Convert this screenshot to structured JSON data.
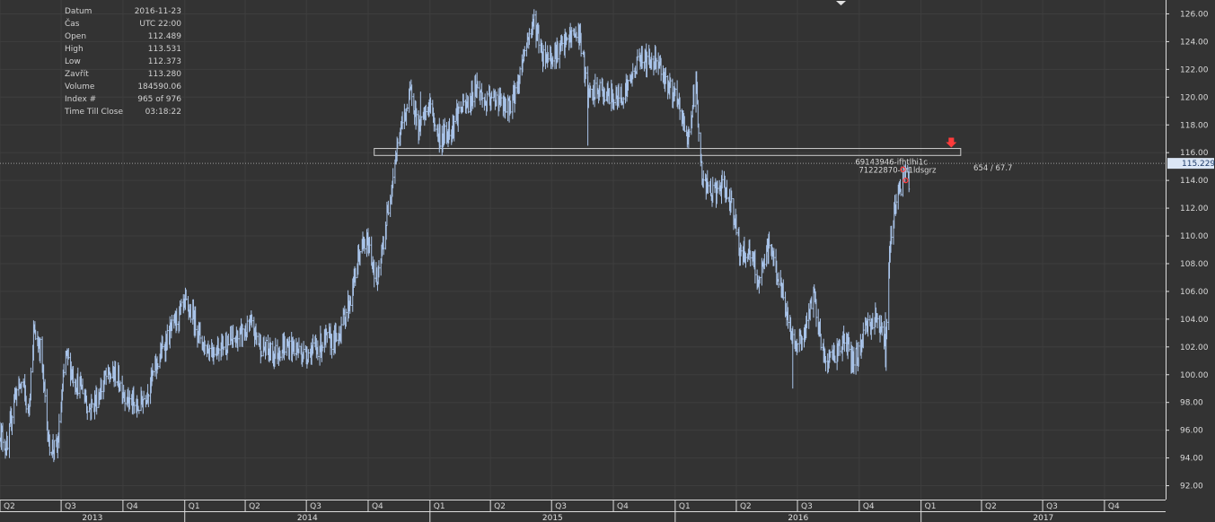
{
  "info": [
    {
      "key": "Datum",
      "value": "2016-11-23"
    },
    {
      "key": "Čas",
      "value": "UTC 22:00"
    },
    {
      "key": "Open",
      "value": "112.489"
    },
    {
      "key": "High",
      "value": "113.531"
    },
    {
      "key": "Low",
      "value": "112.373"
    },
    {
      "key": "Zavřít",
      "value": "113.280"
    },
    {
      "key": "Volume",
      "value": "184590.06"
    },
    {
      "key": "Index #",
      "value": "965 of 976"
    },
    {
      "key": "Time Till Close",
      "value": "03:18:22"
    }
  ],
  "current_price": {
    "label": "115.229",
    "value": 115.229
  },
  "annotations": {
    "rect_label_1": "69143946-ifhtlhi1c",
    "rect_label_2": "71222870-ifr1ldsgrz",
    "ratio_label": "654 / 67.7",
    "zone": {
      "from_date": "2014-10-10",
      "to_date": "2017-03-01",
      "low": 115.8,
      "high": 116.3
    }
  },
  "colors": {
    "background": "#333333",
    "grid": "#3e3e3e",
    "axis_panel": "#ffffff",
    "bars": "#a9c4ea",
    "marker": "#ff3b3b",
    "price_tag": "#dbe6f5",
    "zone": "#cfcfcf"
  },
  "chart_data": {
    "type": "ohlc",
    "title": "",
    "xlabel": "",
    "ylabel": "",
    "ylim": [
      91,
      127
    ],
    "xlim": [
      "2013-04-01",
      "2017-12-31"
    ],
    "y_ticks": [
      "92.00",
      "94.00",
      "96.00",
      "98.00",
      "100.00",
      "102.00",
      "104.00",
      "106.00",
      "108.00",
      "110.00",
      "112.00",
      "114.00",
      "116.00",
      "118.00",
      "120.00",
      "122.00",
      "124.00",
      "126.00"
    ],
    "quarters": [
      {
        "label": "Q2",
        "date": "2013-04-01"
      },
      {
        "label": "Q3",
        "date": "2013-07-01"
      },
      {
        "label": "Q4",
        "date": "2013-10-01"
      },
      {
        "label": "Q1",
        "date": "2014-01-01"
      },
      {
        "label": "Q2",
        "date": "2014-04-01"
      },
      {
        "label": "Q3",
        "date": "2014-07-01"
      },
      {
        "label": "Q4",
        "date": "2014-10-01"
      },
      {
        "label": "Q1",
        "date": "2015-01-01"
      },
      {
        "label": "Q2",
        "date": "2015-04-01"
      },
      {
        "label": "Q3",
        "date": "2015-07-01"
      },
      {
        "label": "Q4",
        "date": "2015-10-01"
      },
      {
        "label": "Q1",
        "date": "2016-01-01"
      },
      {
        "label": "Q2",
        "date": "2016-04-01"
      },
      {
        "label": "Q3",
        "date": "2016-07-01"
      },
      {
        "label": "Q4",
        "date": "2016-10-01"
      },
      {
        "label": "Q1",
        "date": "2017-01-01"
      },
      {
        "label": "Q2",
        "date": "2017-04-01"
      },
      {
        "label": "Q3",
        "date": "2017-07-01"
      },
      {
        "label": "Q4",
        "date": "2017-10-01"
      }
    ],
    "years": [
      {
        "label": "2013",
        "date": "2013-04-01"
      },
      {
        "label": "2014",
        "date": "2014-01-01"
      },
      {
        "label": "2015",
        "date": "2015-01-01"
      },
      {
        "label": "2016",
        "date": "2016-01-01"
      },
      {
        "label": "2017",
        "date": "2017-01-01"
      }
    ],
    "series_path": [
      [
        "2013-04-01",
        96.0
      ],
      [
        "2013-04-12",
        94.5
      ],
      [
        "2013-04-22",
        98.5
      ],
      [
        "2013-05-05",
        99.5
      ],
      [
        "2013-05-13",
        97.0
      ],
      [
        "2013-05-21",
        103.0
      ],
      [
        "2013-05-31",
        102.0
      ],
      [
        "2013-06-13",
        95.0
      ],
      [
        "2013-06-25",
        94.5
      ],
      [
        "2013-07-08",
        101.5
      ],
      [
        "2013-07-22",
        99.5
      ],
      [
        "2013-08-02",
        99.0
      ],
      [
        "2013-08-12",
        97.5
      ],
      [
        "2013-08-26",
        98.5
      ],
      [
        "2013-09-05",
        99.8
      ],
      [
        "2013-09-20",
        100.0
      ],
      [
        "2013-10-05",
        98.5
      ],
      [
        "2013-10-22",
        97.5
      ],
      [
        "2013-11-08",
        99.0
      ],
      [
        "2013-11-22",
        101.0
      ],
      [
        "2013-12-05",
        102.5
      ],
      [
        "2013-12-20",
        104.0
      ],
      [
        "2014-01-02",
        105.0
      ],
      [
        "2014-01-15",
        104.0
      ],
      [
        "2014-01-30",
        102.0
      ],
      [
        "2014-02-12",
        101.8
      ],
      [
        "2014-02-27",
        102.2
      ],
      [
        "2014-03-15",
        102.5
      ],
      [
        "2014-03-31",
        103.0
      ],
      [
        "2014-04-10",
        103.5
      ],
      [
        "2014-04-25",
        102.0
      ],
      [
        "2014-05-12",
        101.5
      ],
      [
        "2014-05-28",
        102.0
      ],
      [
        "2014-06-12",
        102.0
      ],
      [
        "2014-06-27",
        101.5
      ],
      [
        "2014-07-14",
        101.8
      ],
      [
        "2014-07-30",
        102.5
      ],
      [
        "2014-08-15",
        102.5
      ],
      [
        "2014-08-25",
        104.0
      ],
      [
        "2014-09-05",
        105.5
      ],
      [
        "2014-09-19",
        109.0
      ],
      [
        "2014-10-01",
        109.5
      ],
      [
        "2014-10-15",
        106.5
      ],
      [
        "2014-10-31",
        112.0
      ],
      [
        "2014-11-10",
        115.5
      ],
      [
        "2014-11-20",
        118.0
      ],
      [
        "2014-12-05",
        120.5
      ],
      [
        "2014-12-15",
        117.5
      ],
      [
        "2014-12-31",
        119.5
      ],
      [
        "2015-01-15",
        117.0
      ],
      [
        "2015-01-30",
        117.5
      ],
      [
        "2015-02-12",
        119.0
      ],
      [
        "2015-03-01",
        119.5
      ],
      [
        "2015-03-10",
        121.0
      ],
      [
        "2015-03-25",
        119.5
      ],
      [
        "2015-04-10",
        120.0
      ],
      [
        "2015-04-25",
        119.0
      ],
      [
        "2015-05-10",
        120.5
      ],
      [
        "2015-05-22",
        123.5
      ],
      [
        "2015-06-05",
        125.5
      ],
      [
        "2015-06-18",
        123.0
      ],
      [
        "2015-07-01",
        123.0
      ],
      [
        "2015-07-15",
        123.5
      ],
      [
        "2015-08-01",
        124.5
      ],
      [
        "2015-08-12",
        124.5
      ],
      [
        "2015-08-24",
        120.0
      ],
      [
        "2015-09-10",
        120.5
      ],
      [
        "2015-09-25",
        120.0
      ],
      [
        "2015-10-10",
        120.0
      ],
      [
        "2015-10-25",
        121.0
      ],
      [
        "2015-11-10",
        123.0
      ],
      [
        "2015-11-25",
        122.5
      ],
      [
        "2015-12-05",
        123.0
      ],
      [
        "2015-12-15",
        121.5
      ],
      [
        "2016-01-05",
        119.5
      ],
      [
        "2016-01-20",
        117.0
      ],
      [
        "2016-02-01",
        121.0
      ],
      [
        "2016-02-10",
        114.0
      ],
      [
        "2016-02-25",
        113.0
      ],
      [
        "2016-03-10",
        113.5
      ],
      [
        "2016-03-25",
        112.5
      ],
      [
        "2016-04-08",
        108.5
      ],
      [
        "2016-04-20",
        109.0
      ],
      [
        "2016-05-05",
        106.5
      ],
      [
        "2016-05-20",
        109.5
      ],
      [
        "2016-06-05",
        106.5
      ],
      [
        "2016-06-24",
        102.5
      ],
      [
        "2016-07-10",
        102.5
      ],
      [
        "2016-07-25",
        106.0
      ],
      [
        "2016-08-10",
        101.0
      ],
      [
        "2016-08-25",
        101.5
      ],
      [
        "2016-09-10",
        102.5
      ],
      [
        "2016-09-20",
        101.0
      ],
      [
        "2016-09-30",
        101.5
      ],
      [
        "2016-10-10",
        103.5
      ],
      [
        "2016-10-25",
        104.0
      ],
      [
        "2016-11-05",
        103.5
      ],
      [
        "2016-11-09",
        101.5
      ],
      [
        "2016-11-15",
        108.5
      ],
      [
        "2016-11-23",
        112.5
      ],
      [
        "2016-12-01",
        113.5
      ],
      [
        "2016-12-08",
        114.5
      ],
      [
        "2016-12-14",
        114.0
      ]
    ]
  }
}
